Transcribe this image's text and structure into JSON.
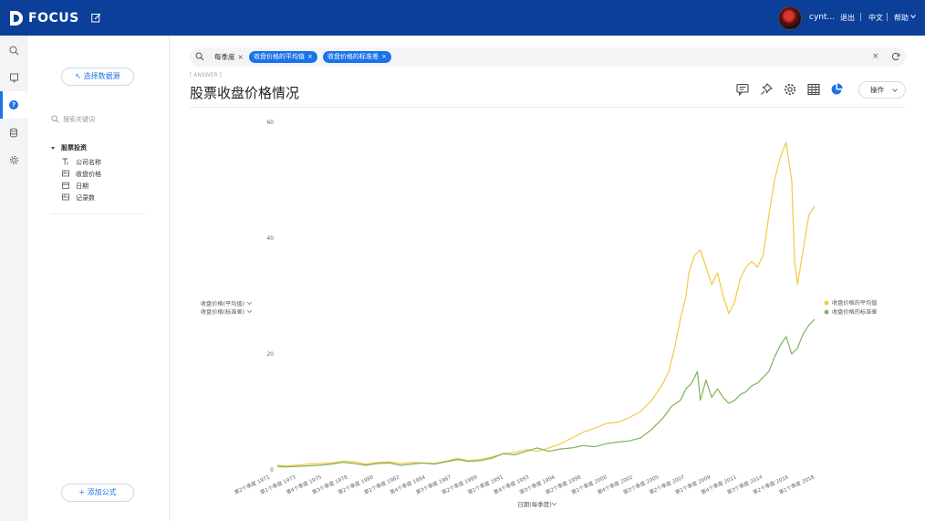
{
  "app": {
    "brand": "FOCUS",
    "username": "cynt...",
    "nav": {
      "logout": "退出",
      "lang": "中文",
      "help": "帮助"
    },
    "colors": {
      "topbar": "#0b3f99",
      "accent": "#1a73e8"
    }
  },
  "rail": {
    "items": [
      "search-icon",
      "bookmark-icon",
      "question-icon",
      "database-icon",
      "gear-icon"
    ],
    "active": "question-icon"
  },
  "panel": {
    "select_source": "选择数据源",
    "search_placeholder": "搜索关键词",
    "tree": {
      "root": "股票投资",
      "items": [
        {
          "icon": "text-field-icon",
          "label": "公司名称"
        },
        {
          "icon": "number-field-icon",
          "label": "收盘价格"
        },
        {
          "icon": "date-field-icon",
          "label": "日期"
        },
        {
          "icon": "number-field-icon",
          "label": "记录数"
        }
      ]
    },
    "add_formula": "+ 添加公式"
  },
  "search": {
    "plain_token": "每季度",
    "tokens": [
      "收盘价格的平均值",
      "收盘价格的标准差"
    ]
  },
  "answer": {
    "tag": "[ ANSWER ]",
    "title": "股票收盘价格情况",
    "toolbar": [
      "comment-icon",
      "pin-icon",
      "gear-icon",
      "table-icon",
      "pie-chart-icon"
    ],
    "ops_label": "操作"
  },
  "chart_data": {
    "type": "line",
    "title": "",
    "ylabel_lines": [
      "收盘价格(平均值)",
      "收盘价格(标准差)"
    ],
    "xlabel": "日期(每季度)",
    "ylim": [
      0,
      60
    ],
    "yticks": [
      "0",
      "20",
      "40",
      "60"
    ],
    "legend_position": "right",
    "legend": [
      "收盘价格的平均值",
      "收盘价格的标准差"
    ],
    "xtick_labels": [
      "第2个季度 1971",
      "第1个季度 1973",
      "第4个季度 1975",
      "第3个季度 1978",
      "第2个季度 1980",
      "第1个季度 1982",
      "第4个季度 1984",
      "第3个季度 1987",
      "第2个季度 1989",
      "第1个季度 1991",
      "第4个季度 1993",
      "第3个季度 1996",
      "第2个季度 1998",
      "第1个季度 2000",
      "第4个季度 2002",
      "第3个季度 2005",
      "第2个季度 2007",
      "第1个季度 2009",
      "第4个季度 2011",
      "第3个季度 2014",
      "第2个季度 2016",
      "第1个季度 2018"
    ],
    "x_start": 1971.25,
    "x_end": 2018.25,
    "series": [
      {
        "name": "收盘价格的平均值",
        "color": "#f5c842",
        "points": [
          [
            1971.25,
            0.8
          ],
          [
            1972,
            0.7
          ],
          [
            1973,
            0.8
          ],
          [
            1974,
            1.0
          ],
          [
            1975,
            1.1
          ],
          [
            1976,
            1.2
          ],
          [
            1977,
            1.5
          ],
          [
            1978,
            1.4
          ],
          [
            1979,
            1.0
          ],
          [
            1980,
            1.3
          ],
          [
            1981,
            1.4
          ],
          [
            1982,
            1.1
          ],
          [
            1983,
            1.3
          ],
          [
            1984,
            1.2
          ],
          [
            1985,
            1.1
          ],
          [
            1986,
            1.5
          ],
          [
            1987,
            2.0
          ],
          [
            1988,
            1.6
          ],
          [
            1989,
            1.8
          ],
          [
            1990,
            2.2
          ],
          [
            1991,
            2.8
          ],
          [
            1992,
            3.0
          ],
          [
            1993,
            3.5
          ],
          [
            1994,
            3.2
          ],
          [
            1995,
            3.8
          ],
          [
            1996,
            4.5
          ],
          [
            1997,
            5.5
          ],
          [
            1998,
            6.5
          ],
          [
            1999,
            7.2
          ],
          [
            2000,
            8.0
          ],
          [
            2001,
            8.2
          ],
          [
            2002,
            9.0
          ],
          [
            2003,
            10.0
          ],
          [
            2004,
            12.0
          ],
          [
            2005,
            15.0
          ],
          [
            2005.5,
            17.0
          ],
          [
            2006,
            21.0
          ],
          [
            2006.5,
            26.0
          ],
          [
            2007,
            30.0
          ],
          [
            2007.25,
            34.0
          ],
          [
            2007.75,
            37.0
          ],
          [
            2008.25,
            38.0
          ],
          [
            2008.75,
            35.0
          ],
          [
            2009.25,
            32.0
          ],
          [
            2009.75,
            34.0
          ],
          [
            2010.25,
            30.0
          ],
          [
            2010.75,
            27.0
          ],
          [
            2011.25,
            29.0
          ],
          [
            2011.75,
            33.0
          ],
          [
            2012.25,
            35.0
          ],
          [
            2012.75,
            36.0
          ],
          [
            2013.25,
            35.0
          ],
          [
            2013.75,
            37.0
          ],
          [
            2014.25,
            44.0
          ],
          [
            2014.75,
            50.0
          ],
          [
            2015.25,
            54.0
          ],
          [
            2015.75,
            56.5
          ],
          [
            2016.25,
            50.0
          ],
          [
            2016.5,
            36.0
          ],
          [
            2016.75,
            32.0
          ],
          [
            2017.25,
            38.0
          ],
          [
            2017.75,
            44.0
          ],
          [
            2018.25,
            45.5
          ]
        ]
      },
      {
        "name": "收盘价格的标准差",
        "color": "#7cb45c",
        "points": [
          [
            1971.25,
            0.6
          ],
          [
            1972,
            0.5
          ],
          [
            1973,
            0.6
          ],
          [
            1974,
            0.7
          ],
          [
            1975,
            0.8
          ],
          [
            1976,
            1.0
          ],
          [
            1977,
            1.3
          ],
          [
            1978,
            1.1
          ],
          [
            1979,
            0.8
          ],
          [
            1980,
            1.1
          ],
          [
            1981,
            1.2
          ],
          [
            1982,
            0.8
          ],
          [
            1983,
            1.0
          ],
          [
            1984,
            1.2
          ],
          [
            1985,
            1.0
          ],
          [
            1986,
            1.4
          ],
          [
            1987,
            1.8
          ],
          [
            1988,
            1.5
          ],
          [
            1989,
            1.6
          ],
          [
            1990,
            2.0
          ],
          [
            1991,
            2.8
          ],
          [
            1992,
            2.6
          ],
          [
            1993,
            3.2
          ],
          [
            1994,
            3.8
          ],
          [
            1995,
            3.2
          ],
          [
            1996,
            3.6
          ],
          [
            1997,
            3.8
          ],
          [
            1998,
            4.2
          ],
          [
            1999,
            4.0
          ],
          [
            2000,
            4.5
          ],
          [
            2001,
            4.8
          ],
          [
            2002,
            5.0
          ],
          [
            2003,
            5.5
          ],
          [
            2004,
            7.0
          ],
          [
            2005,
            9.0
          ],
          [
            2005.75,
            11.0
          ],
          [
            2006.5,
            12.0
          ],
          [
            2007,
            14.0
          ],
          [
            2007.5,
            15.0
          ],
          [
            2008,
            17.0
          ],
          [
            2008.25,
            12.0
          ],
          [
            2008.75,
            15.5
          ],
          [
            2009.25,
            12.5
          ],
          [
            2009.75,
            14.0
          ],
          [
            2010.25,
            12.5
          ],
          [
            2010.75,
            11.5
          ],
          [
            2011.25,
            12.0
          ],
          [
            2011.75,
            13.0
          ],
          [
            2012.25,
            13.5
          ],
          [
            2012.75,
            14.5
          ],
          [
            2013.25,
            15.0
          ],
          [
            2013.75,
            16.0
          ],
          [
            2014.25,
            17.0
          ],
          [
            2014.75,
            19.5
          ],
          [
            2015.25,
            21.5
          ],
          [
            2015.75,
            23.0
          ],
          [
            2016.25,
            20.0
          ],
          [
            2016.75,
            21.0
          ],
          [
            2017.25,
            23.5
          ],
          [
            2017.75,
            25.0
          ],
          [
            2018.25,
            26.0
          ]
        ]
      }
    ]
  }
}
